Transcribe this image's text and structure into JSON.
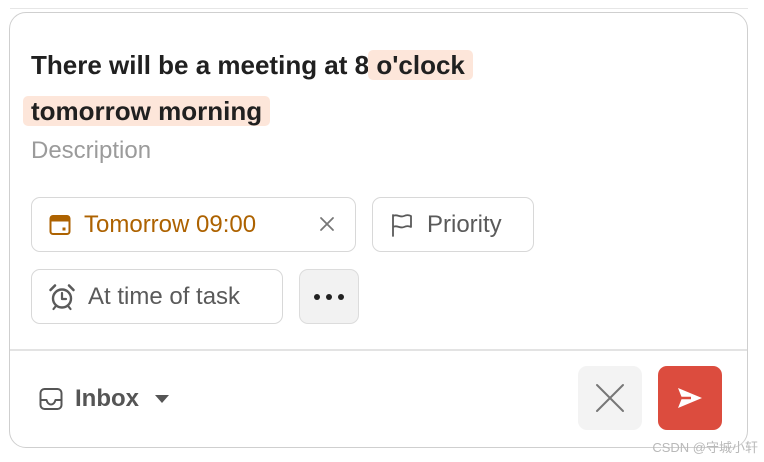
{
  "task": {
    "title_part1": "There will be a meeting at 8 ",
    "title_part2": "o'clock tomorrow morning",
    "description_placeholder": "Description"
  },
  "chips": {
    "due": {
      "label": "Tomorrow 09:00",
      "icon": "calendar-icon",
      "clear_icon": "close-icon",
      "color": "#ad6200"
    },
    "priority": {
      "label": "Priority",
      "icon": "flag-icon"
    },
    "reminder": {
      "label": "At time of task",
      "icon": "alarm-clock-icon"
    },
    "more": {
      "icon": "more-horizontal-icon"
    }
  },
  "footer": {
    "project": {
      "label": "Inbox",
      "icon": "inbox-icon",
      "caret_icon": "caret-down-icon"
    },
    "cancel_icon": "close-icon",
    "submit_icon": "send-icon",
    "submit_color": "#dc4c3e"
  },
  "watermark": "CSDN @守城小轩"
}
